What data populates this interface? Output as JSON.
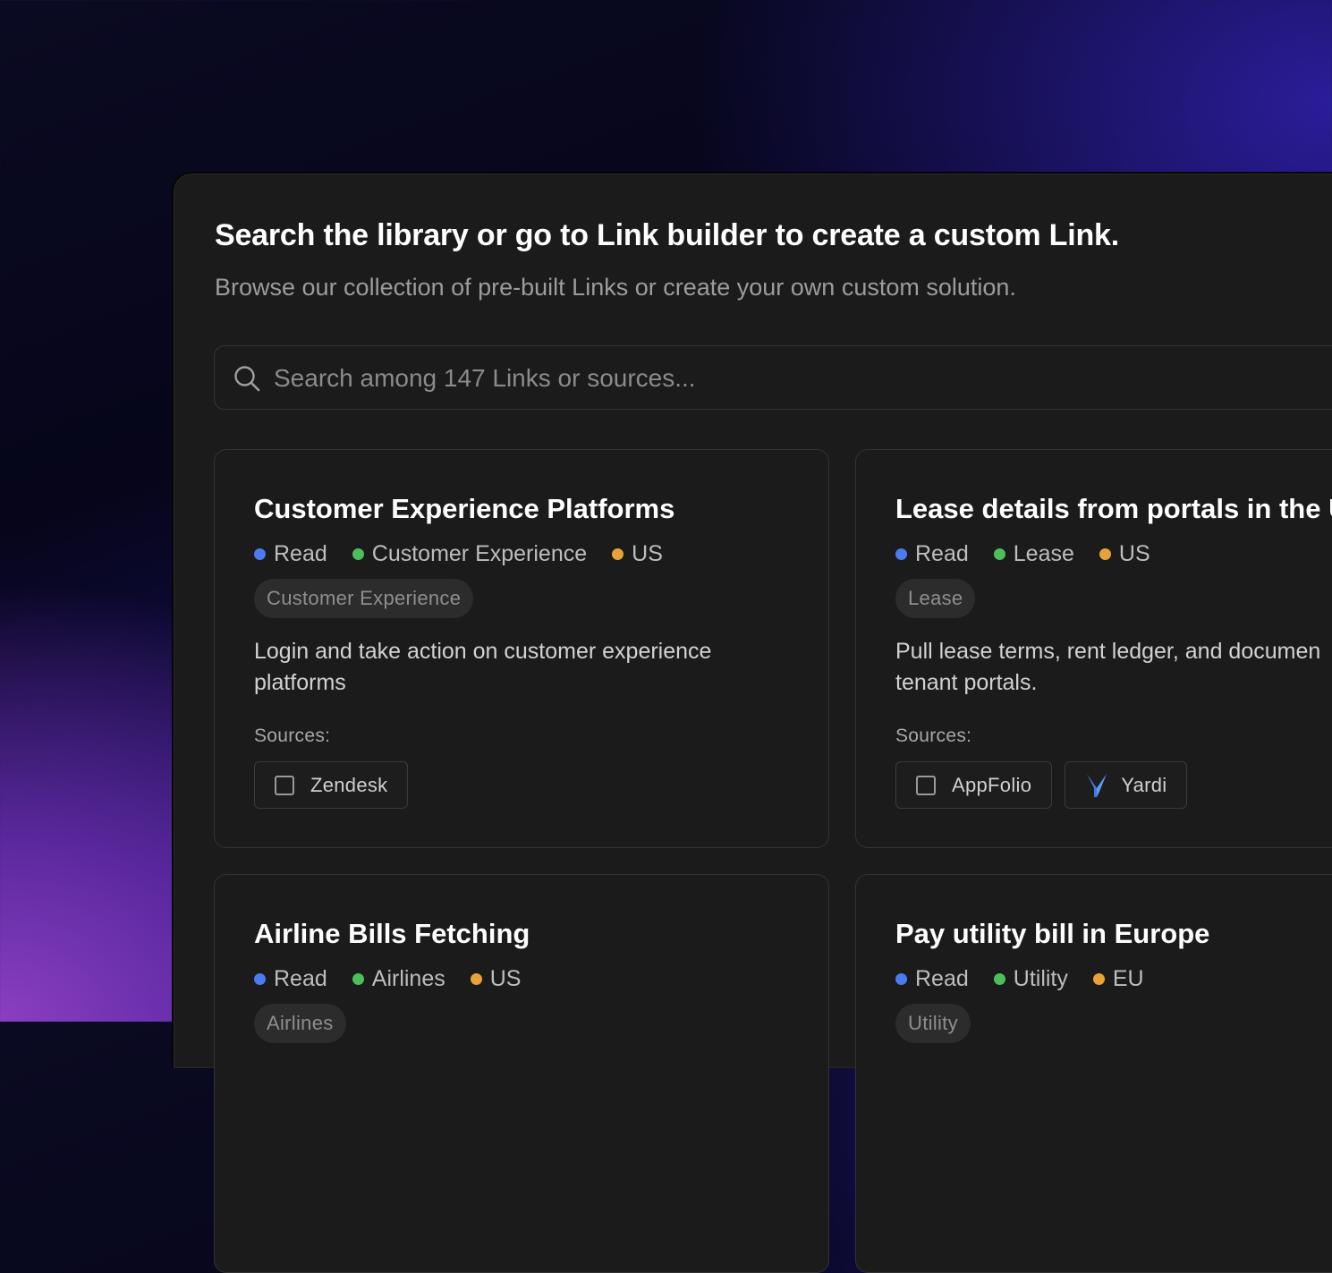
{
  "header": {
    "title": "Search the library or go to Link builder to create a custom Link.",
    "subtitle": "Browse our collection of pre-built Links or create your own custom solution."
  },
  "search": {
    "placeholder": "Search among 147 Links or sources..."
  },
  "colors": {
    "mode_dot": "#4a7bf0",
    "category_dot": "#4bbf5a",
    "region_dot": "#e8a23a"
  },
  "cards": [
    {
      "title": "Customer Experience Platforms",
      "mode": "Read",
      "category": "Customer Experience",
      "region": "US",
      "pill": "Customer Experience",
      "description_lines": [
        "Login and take action on customer experience",
        "platforms"
      ],
      "sources_label": "Sources:",
      "sources": [
        {
          "name": "Zendesk",
          "icon": "placeholder-square-icon"
        }
      ]
    },
    {
      "title": "Lease details from portals in the U",
      "mode": "Read",
      "category": "Lease",
      "region": "US",
      "pill": "Lease",
      "description_lines": [
        "Pull lease terms, rent ledger, and documen",
        "tenant portals."
      ],
      "sources_label": "Sources:",
      "sources": [
        {
          "name": "AppFolio",
          "icon": "placeholder-square-icon"
        },
        {
          "name": "Yardi",
          "icon": "yardi-logo-icon"
        }
      ]
    },
    {
      "title": "Airline Bills Fetching",
      "mode": "Read",
      "category": "Airlines",
      "region": "US",
      "pill": "Airlines"
    },
    {
      "title": "Pay utility bill in Europe",
      "mode": "Read",
      "category": "Utility",
      "region": "EU",
      "pill": "Utility"
    }
  ]
}
